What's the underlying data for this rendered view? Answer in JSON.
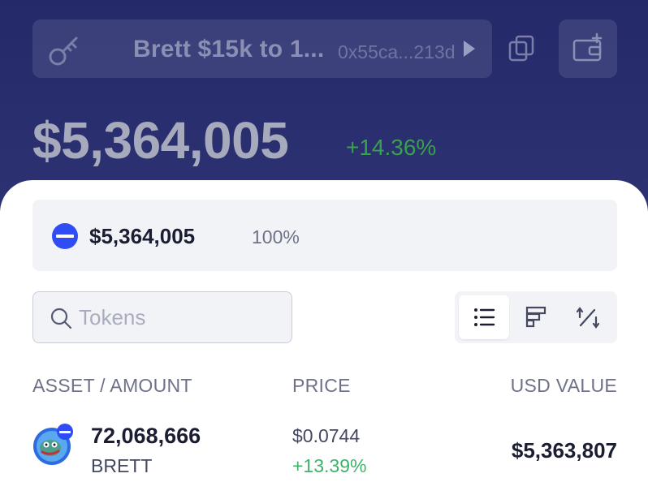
{
  "wallet": {
    "name": "Brett $15k to 1...",
    "address": "0x55ca...213d"
  },
  "portfolio": {
    "balance": "$5,364,005",
    "change": "+14.36%"
  },
  "allocation": {
    "value": "$5,364,005",
    "percent": "100%",
    "color": "#2f4cf5"
  },
  "search": {
    "placeholder": "Tokens",
    "value": ""
  },
  "view_toggle": {
    "options": [
      "list-view",
      "bar-view",
      "sort-view"
    ],
    "active": "list-view"
  },
  "table": {
    "headers": {
      "asset": "ASSET / AMOUNT",
      "price": "PRICE",
      "usd": "USD VALUE"
    },
    "rows": [
      {
        "amount": "72,068,666",
        "symbol": "BRETT",
        "price": "$0.0744",
        "change": "+13.39%",
        "usd_value": "$5,363,807",
        "icon": "brett-token-icon"
      }
    ]
  },
  "colors": {
    "header_bg": "#27296b",
    "positive": "#3aa04a",
    "accent": "#2f4cf5"
  }
}
